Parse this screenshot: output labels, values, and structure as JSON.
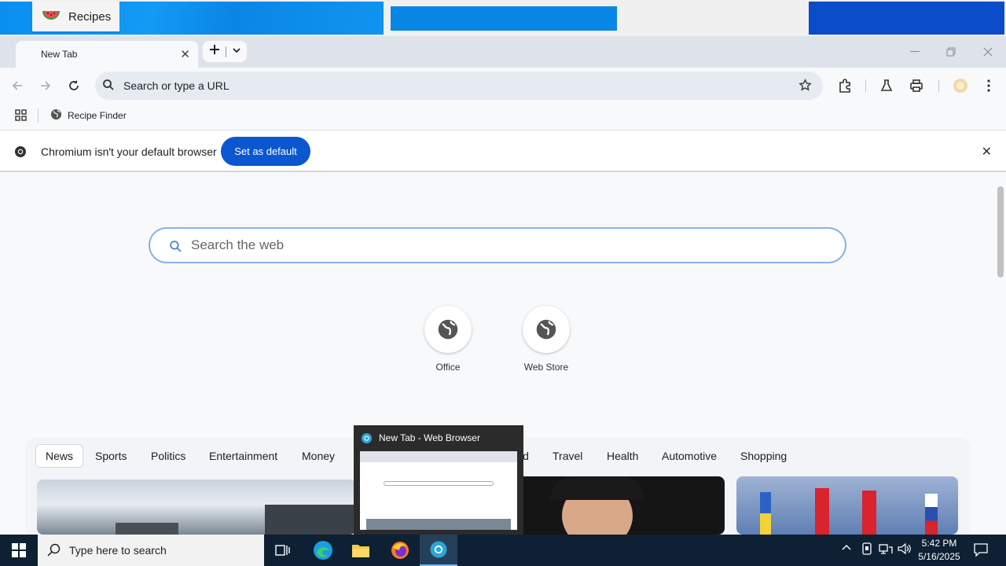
{
  "app_strip": {
    "tab_label": "Recipes"
  },
  "browser": {
    "tab_title": "New Tab",
    "omnibox_placeholder": "Search or type a URL",
    "bookmark": "Recipe Finder",
    "infobar": {
      "message": "Chromium isn't your default browser",
      "button": "Set as default"
    }
  },
  "page": {
    "search_placeholder": "Search the web",
    "shortcuts": [
      {
        "label": "Office"
      },
      {
        "label": "Web Store"
      }
    ],
    "categories": [
      "News",
      "Sports",
      "Politics",
      "Entertainment",
      "Money",
      "Food",
      "Travel",
      "Health",
      "Automotive",
      "Shopping"
    ],
    "active_category": "News"
  },
  "preview": {
    "title": "New Tab - Web Browser"
  },
  "taskbar": {
    "search_placeholder": "Type here to search",
    "time": "5:42 PM",
    "date": "5/16/2025"
  },
  "colors": {
    "accent": "#0b57d0",
    "taskbar": "#0e2033"
  }
}
